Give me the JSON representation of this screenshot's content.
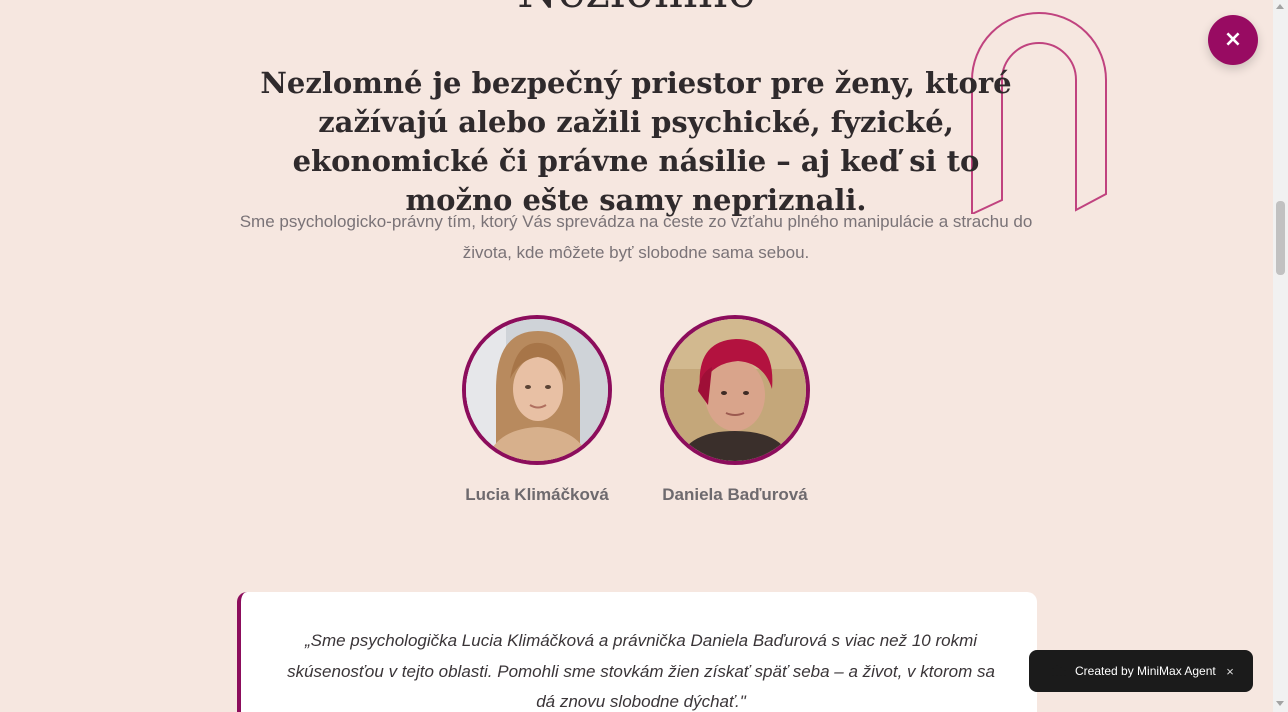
{
  "hero": {
    "brand_title": "Nezlomné",
    "headline": "Nezlomné je bezpečný priestor pre ženy, ktoré zažívajú alebo zažili psychické, fyzické, ekonomické či právne násilie – aj keď si to možno ešte samy nepriznali.",
    "subtext": "Sme psychologicko-právny tím, ktorý Vás sprevádza na ceste zo vzťahu plného manipulácie a strachu do života, kde môžete byť slobodne sama sebou."
  },
  "team": [
    {
      "name": "Lucia Klimáčková"
    },
    {
      "name": "Daniela Baďurová"
    }
  ],
  "quote": {
    "text": "„Sme psychologička Lucia Klimáčková a právnička Daniela Baďurová s viac než 10 rokmi skúsenosťou v tejto oblasti. Pomohli sme stovkám žien získať späť seba – a život, v ktorom sa dá znovu slobodne dýchať.\""
  },
  "close_button": {
    "label": "×"
  },
  "toast": {
    "text": "Created by MiniMax Agent",
    "close_label": "×"
  },
  "colors": {
    "background": "#f6e7e0",
    "accent": "#8c0d5c",
    "arch_outline": "#c0437f"
  }
}
